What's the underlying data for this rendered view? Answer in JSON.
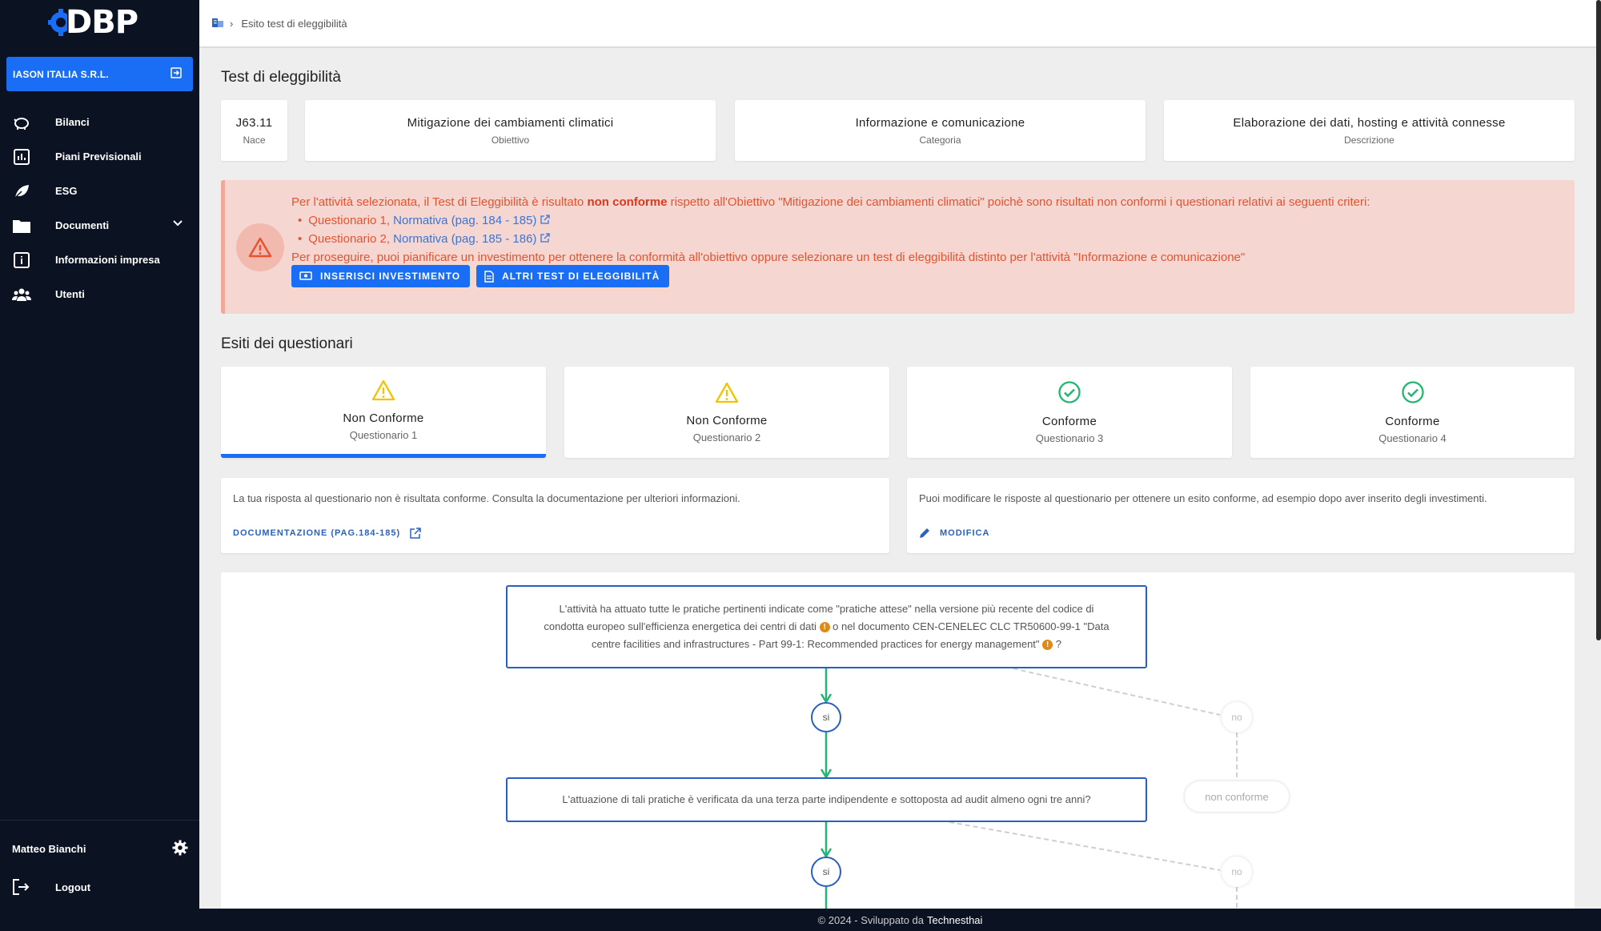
{
  "app": {
    "logo_text": "DBP"
  },
  "sidebar": {
    "company": "IASON ITALIA S.R.L.",
    "items": [
      {
        "label": "Bilanci",
        "icon": "piggy-bank-icon"
      },
      {
        "label": "Piani Previsionali",
        "icon": "bar-chart-icon"
      },
      {
        "label": "ESG",
        "icon": "leaf-icon"
      },
      {
        "label": "Documenti",
        "icon": "folder-icon"
      },
      {
        "label": "Informazioni impresa",
        "icon": "info-icon"
      },
      {
        "label": "Utenti",
        "icon": "users-icon"
      }
    ],
    "user_name": "Matteo Bianchi",
    "logout": "Logout"
  },
  "breadcrumb": {
    "current": "Esito test di eleggibilità"
  },
  "test": {
    "title": "Test di eleggibilità",
    "nace": {
      "value": "J63.11",
      "label": "Nace"
    },
    "obiettivo": {
      "value": "Mitigazione dei cambiamenti climatici",
      "label": "Obiettivo"
    },
    "categoria": {
      "value": "Informazione e comunicazione",
      "label": "Categoria"
    },
    "descrizione": {
      "value": "Elaborazione dei dati, hosting e attività connesse",
      "label": "Descrizione"
    }
  },
  "alert": {
    "line1_pre": "Per l'attività selezionata, il Test di Eleggibilità è risultato ",
    "line1_bold": "non conforme",
    "line1_post": " rispetto all'Obiettivo \"Mitigazione dei cambiamenti climatici\" poichè sono risultati non conformi i questionari relativi ai seguenti criteri:",
    "items": [
      {
        "label": "Questionario 1, ",
        "link": "Normativa (pag. 184 - 185)"
      },
      {
        "label": "Questionario 2, ",
        "link": "Normativa (pag. 185 - 186)"
      }
    ],
    "line2": "Per proseguire, puoi pianificare un investimento per ottenere la conformità all'obiettivo oppure selezionare un test di eleggibilità distinto per l'attività \"Informazione e comunicazione\"",
    "btn_invest": "INSERISCI INVESTIMENTO",
    "btn_other": "ALTRI TEST DI ELEGGIBILITÀ"
  },
  "esiti": {
    "title": "Esiti dei questionari",
    "cards": [
      {
        "status": "Non Conforme",
        "sub": "Questionario 1",
        "icon": "warning-icon"
      },
      {
        "status": "Non Conforme",
        "sub": "Questionario 2",
        "icon": "warning-icon"
      },
      {
        "status": "Conforme",
        "sub": "Questionario 3",
        "icon": "check-circle-icon"
      },
      {
        "status": "Conforme",
        "sub": "Questionario 4",
        "icon": "check-circle-icon"
      }
    ],
    "left_text": "La tua risposta al questionario non è risultata conforme. Consulta la documentazione per ulteriori informazioni.",
    "left_action": "DOCUMENTAZIONE (PAG.184-185)",
    "right_text": "Puoi modificare le risposte al questionario per ottenere un esito conforme, ad esempio dopo aver inserito degli investimenti.",
    "right_action": "MODIFICA"
  },
  "flow": {
    "q1_l1": "L'attività ha attuato tutte le pratiche pertinenti indicate come \"pratiche attese\" nella versione più recente del codice di",
    "q1_l2a": "condotta europeo sull'efficienza energetica dei centri di dati",
    "q1_l2b": " o nel documento CEN-CENELEC CLC TR50600-99-1 \"Data",
    "q1_l3a": "centre facilities and infrastructures - Part 99-1: Recommended practices for energy management\"",
    "q1_l3b": " ?",
    "q2": "L'attuazione di tali pratiche è verificata da una terza parte indipendente e sottoposta ad audit almeno ogni tre anni?",
    "yes": "si",
    "no": "no",
    "non_conforme": "non conforme"
  },
  "footer": {
    "text": "© 2024 - Sviluppato da",
    "brand": "Technesthai"
  },
  "colors": {
    "primary": "#1a6ef5",
    "sidebar": "#0b1221",
    "alert_bg": "#f6d6d0",
    "alert_text": "#e5532f",
    "ok": "#22b573",
    "warn": "#f2c300"
  }
}
